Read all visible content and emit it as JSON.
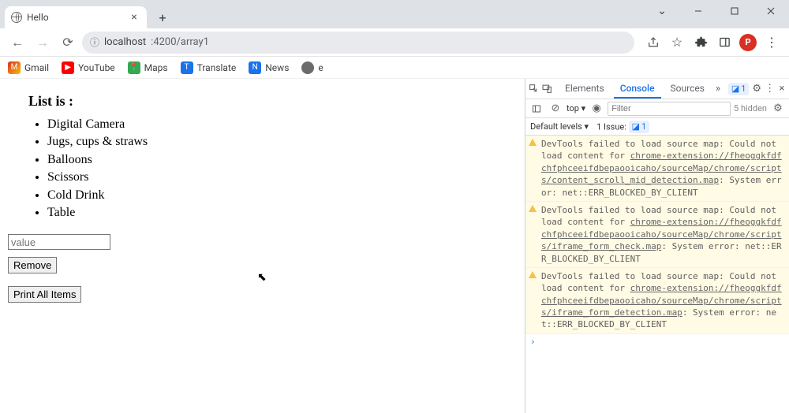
{
  "tab": {
    "title": "Hello"
  },
  "window_controls": {
    "chevron": "⌄"
  },
  "addr": {
    "protocol_icon": "ⓘ",
    "host": "localhost",
    "rest": ":4200/array1",
    "avatar_letter": "P"
  },
  "bookmarks": [
    {
      "name": "gmail",
      "icon": "M",
      "cls": "gm",
      "label": "Gmail"
    },
    {
      "name": "youtube",
      "icon": "▶",
      "cls": "yt",
      "label": "YouTube"
    },
    {
      "name": "maps",
      "icon": "📍",
      "cls": "mp",
      "label": "Maps"
    },
    {
      "name": "translate",
      "icon": "T",
      "cls": "tr",
      "label": "Translate"
    },
    {
      "name": "news",
      "icon": "N",
      "cls": "ns",
      "label": "News"
    },
    {
      "name": "e",
      "icon": "",
      "cls": "eg",
      "label": "e"
    }
  ],
  "page": {
    "heading": "List is :",
    "items": [
      "Digital Camera",
      "Jugs, cups & straws",
      "Balloons",
      "Scissors",
      "Cold Drink",
      "Table"
    ],
    "input_placeholder": "value",
    "remove_label": "Remove",
    "print_label": "Print All Items"
  },
  "devtools": {
    "tabs": [
      "Elements",
      "Console",
      "Sources"
    ],
    "active_tab": "Console",
    "error_badge": "1",
    "context": "top",
    "filter_placeholder": "Filter",
    "hidden_text": "5 hidden",
    "levels_text": "Default levels",
    "issues_text": "1 Issue:",
    "issues_badge": "1",
    "messages": [
      {
        "pre": "DevTools failed to load source map: Could not load content for ",
        "link": "chrome-extension://fheoggkfdfchfphceeifdbepaooicaho/sourceMap/chrome/scripts/content_scroll_mid_detection.map",
        "post": ": System error: net::ERR_BLOCKED_BY_CLIENT"
      },
      {
        "pre": "DevTools failed to load source map: Could not load content for ",
        "link": "chrome-extension://fheoggkfdfchfphceeifdbepaooicaho/sourceMap/chrome/scripts/iframe_form_check.map",
        "post": ": System error: net::ERR_BLOCKED_BY_CLIENT"
      },
      {
        "pre": "DevTools failed to load source map: Could not load content for ",
        "link": "chrome-extension://fheoggkfdfchfphceeifdbepaooicaho/sourceMap/chrome/scripts/iframe_form_detection.map",
        "post": ": System error: net::ERR_BLOCKED_BY_CLIENT"
      }
    ],
    "prompt": "›"
  }
}
